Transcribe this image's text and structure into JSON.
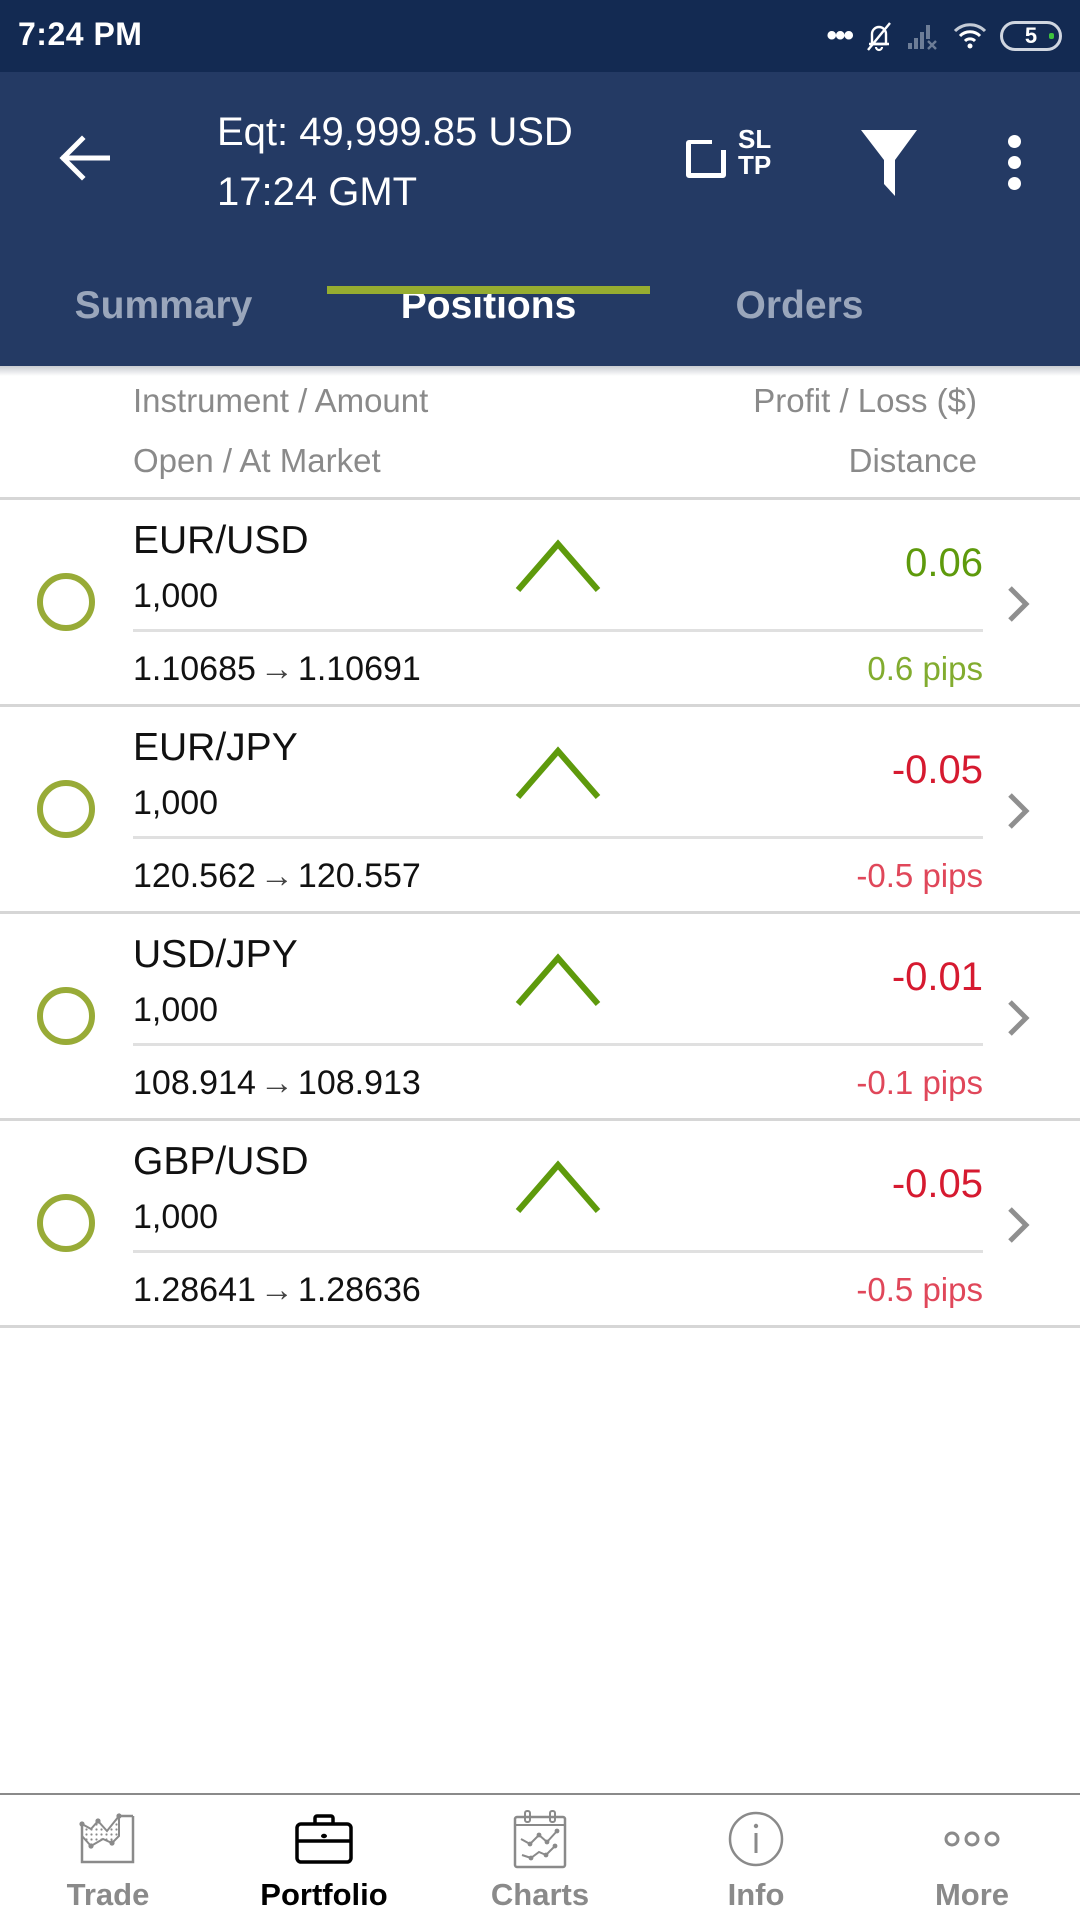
{
  "status_bar": {
    "time": "7:24 PM",
    "battery_level": "5",
    "icons": [
      "more-notifications-icon",
      "bell-muted-icon",
      "signal-no-service-icon",
      "wifi-icon",
      "battery-icon"
    ]
  },
  "header": {
    "equity": "Eqt: 49,999.85 USD",
    "time": "17:24 GMT",
    "sltp_label_top": "SL",
    "sltp_label_bottom": "TP",
    "icons": {
      "back": "arrow-left-icon",
      "sltp": "sl-tp-toggle-icon",
      "filter": "filter-icon",
      "more": "more-vertical-icon"
    }
  },
  "tabs": [
    {
      "label": "Summary",
      "active": false
    },
    {
      "label": "Positions",
      "active": true
    },
    {
      "label": "Orders",
      "active": false
    }
  ],
  "colors": {
    "status_bar_bg": "#132a52",
    "header_bg": "#243a64",
    "accent": "#96ad30",
    "positive": "#5e9a0c",
    "negative": "#d61a30"
  },
  "columns": {
    "left_line1": "Instrument / Amount",
    "left_line2": "Open / At Market",
    "right_line1": "Profit / Loss ($)",
    "right_line2": "Distance"
  },
  "positions": [
    {
      "instrument": "EUR/USD",
      "amount": "1,000",
      "direction": "buy",
      "open": "1.10685",
      "market": "1.10691",
      "pl": "0.06",
      "distance": "0.6 pips",
      "sign": "positive"
    },
    {
      "instrument": "EUR/JPY",
      "amount": "1,000",
      "direction": "buy",
      "open": "120.562",
      "market": "120.557",
      "pl": "-0.05",
      "distance": "-0.5 pips",
      "sign": "negative"
    },
    {
      "instrument": "USD/JPY",
      "amount": "1,000",
      "direction": "buy",
      "open": "108.914",
      "market": "108.913",
      "pl": "-0.01",
      "distance": "-0.1 pips",
      "sign": "negative"
    },
    {
      "instrument": "GBP/USD",
      "amount": "1,000",
      "direction": "buy",
      "open": "1.28641",
      "market": "1.28636",
      "pl": "-0.05",
      "distance": "-0.5 pips",
      "sign": "negative"
    }
  ],
  "price_arrow": "→",
  "bottom_nav": [
    {
      "label": "Trade",
      "icon": "trade-chart-icon",
      "active": false
    },
    {
      "label": "Portfolio",
      "icon": "briefcase-icon",
      "active": true
    },
    {
      "label": "Charts",
      "icon": "calendar-chart-icon",
      "active": false
    },
    {
      "label": "Info",
      "icon": "info-icon",
      "active": false
    },
    {
      "label": "More",
      "icon": "more-horizontal-icon",
      "active": false
    }
  ]
}
